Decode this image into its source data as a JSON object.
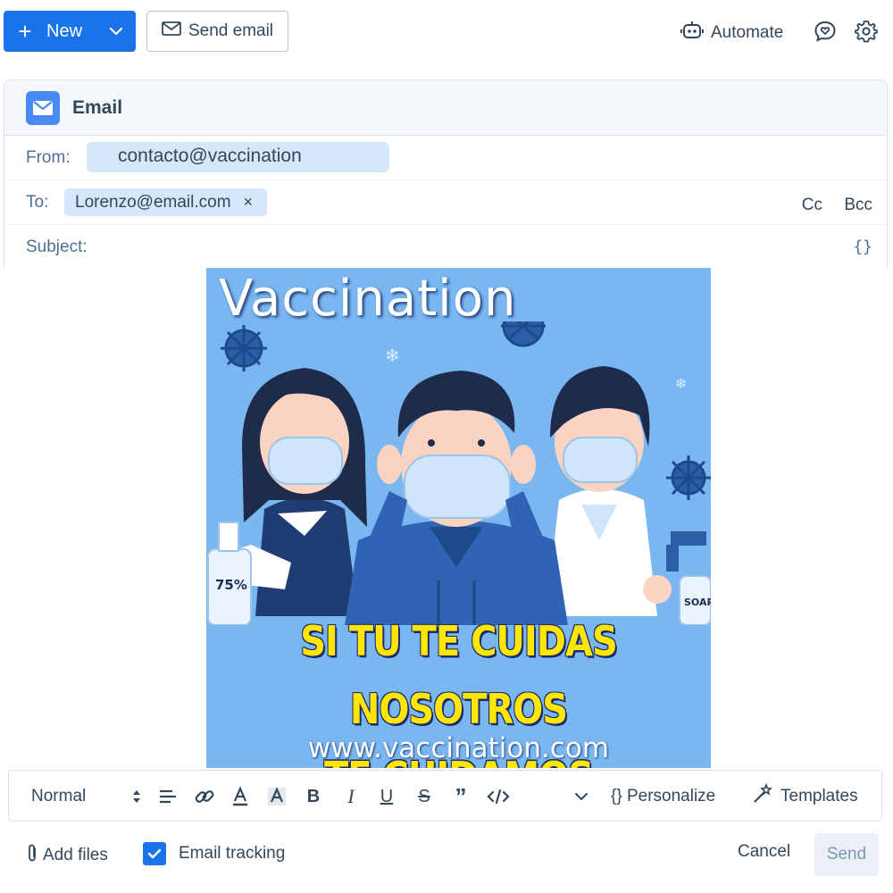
{
  "toolbar": {
    "new_label": "New",
    "send_email_label": "Send email",
    "automate_label": "Automate"
  },
  "email": {
    "header_title": "Email",
    "from_label": "From:",
    "from_value": "contacto@vaccination",
    "to_label": "To:",
    "to_recipient": "Lorenzo@email.com",
    "remove_symbol": "×",
    "cc_label": "Cc",
    "bcc_label": "Bcc",
    "subject_label": "Subject:",
    "subject_value": "",
    "braces": "{}"
  },
  "poster": {
    "title": "Vaccination",
    "slogan_line1": "SI TU TE CUIDAS NOSOTROS",
    "slogan_line2": "TE CUIDAMOS",
    "url": "www.vaccination.com",
    "bottle_label": "75%",
    "soap_label": "SOAP",
    "bg_color": "#7ab6f0",
    "slogan_color": "#ffe600"
  },
  "format_bar": {
    "style_value": "Normal",
    "personalize_label": "{} Personalize",
    "templates_label": "Templates"
  },
  "footer": {
    "add_files_label": "Add files",
    "tracking_label": "Email tracking",
    "tracking_checked": true,
    "cancel_label": "Cancel",
    "send_label": "Send"
  },
  "colors": {
    "primary": "#1a73e8",
    "pill": "#d6e6fb",
    "text": "#33475b",
    "disabled": "#eaf0f6"
  }
}
